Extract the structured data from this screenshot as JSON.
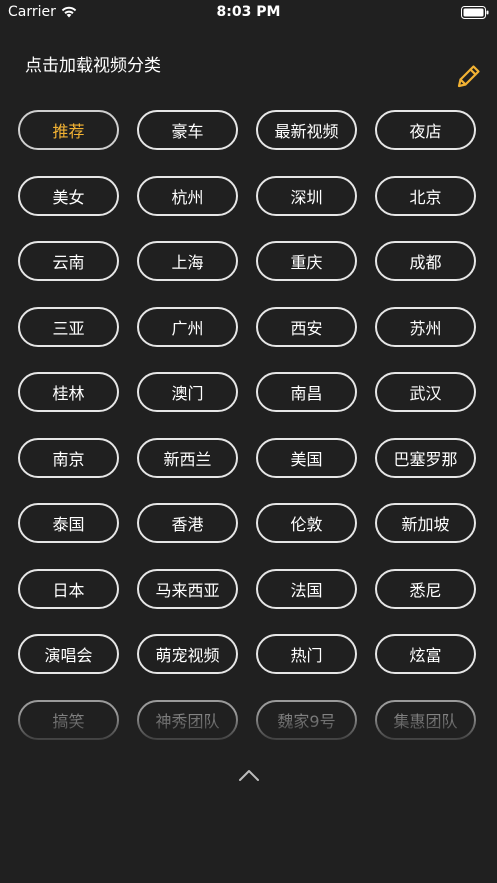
{
  "status_bar": {
    "carrier": "Carrier",
    "time": "8:03 PM",
    "icons": [
      "wifi-icon",
      "battery-icon"
    ]
  },
  "header": {
    "title": "点击加载视频分类",
    "edit_icon": "pencil-icon"
  },
  "colors": {
    "background": "#202020",
    "accent": "#f2b233",
    "border": "#e6e6e6"
  },
  "categories": [
    {
      "label": "推荐",
      "selected": true
    },
    {
      "label": "豪车"
    },
    {
      "label": "最新视频"
    },
    {
      "label": "夜店"
    },
    {
      "label": "美女"
    },
    {
      "label": "杭州"
    },
    {
      "label": "深圳"
    },
    {
      "label": "北京"
    },
    {
      "label": "云南"
    },
    {
      "label": "上海"
    },
    {
      "label": "重庆"
    },
    {
      "label": "成都"
    },
    {
      "label": "三亚"
    },
    {
      "label": "广州"
    },
    {
      "label": "西安"
    },
    {
      "label": "苏州"
    },
    {
      "label": "桂林"
    },
    {
      "label": "澳门"
    },
    {
      "label": "南昌"
    },
    {
      "label": "武汉"
    },
    {
      "label": "南京"
    },
    {
      "label": "新西兰"
    },
    {
      "label": "美国"
    },
    {
      "label": "巴塞罗那"
    },
    {
      "label": "泰国"
    },
    {
      "label": "香港"
    },
    {
      "label": "伦敦"
    },
    {
      "label": "新加坡"
    },
    {
      "label": "日本"
    },
    {
      "label": "马来西亚"
    },
    {
      "label": "法国"
    },
    {
      "label": "悉尼"
    },
    {
      "label": "演唱会"
    },
    {
      "label": "萌宠视频"
    },
    {
      "label": "热门"
    },
    {
      "label": "炫富"
    },
    {
      "label": "搞笑",
      "faded": true
    },
    {
      "label": "神秀团队",
      "faded": true
    },
    {
      "label": "魏家9号",
      "faded": true
    },
    {
      "label": "集惠团队",
      "faded": true
    }
  ],
  "footer": {
    "collapse_icon": "chevron-up-icon"
  }
}
